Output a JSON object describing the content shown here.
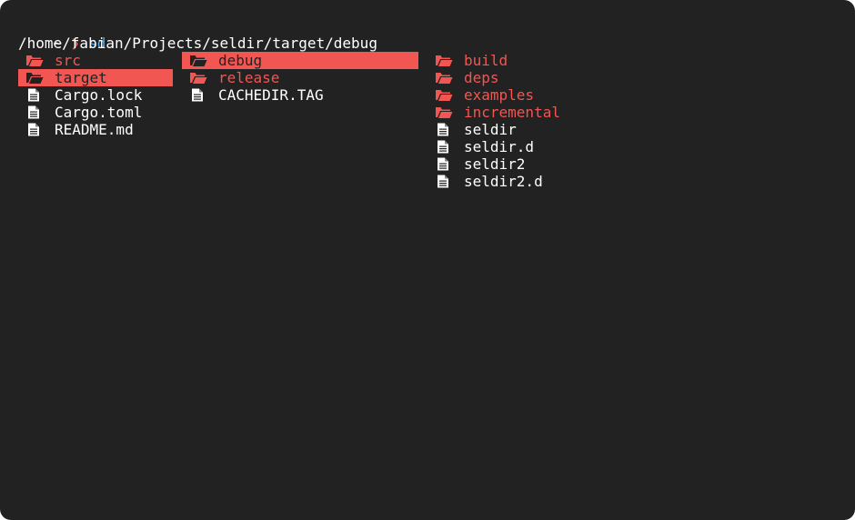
{
  "prompt": {
    "tilde": "~",
    "chevron": "❯",
    "command": "sd"
  },
  "current_path": "/home/fabian/Projects/seldir/target/debug",
  "colors": {
    "background": "#222222",
    "directory": "#f25652",
    "file": "#ffffff",
    "selection": "#f25652",
    "command": "#5aa9e6"
  },
  "columns": [
    [
      {
        "name": "src",
        "type": "dir",
        "icon": "folder-open-icon"
      },
      {
        "name": "target",
        "type": "dir",
        "icon": "folder-open-icon",
        "selected": true
      },
      {
        "name": "Cargo.lock",
        "type": "file",
        "icon": "file-icon"
      },
      {
        "name": "Cargo.toml",
        "type": "file",
        "icon": "file-icon"
      },
      {
        "name": "README.md",
        "type": "file",
        "icon": "file-icon"
      }
    ],
    [
      {
        "name": "debug",
        "type": "dir",
        "icon": "folder-open-icon",
        "selected": true
      },
      {
        "name": "release",
        "type": "dir",
        "icon": "folder-open-icon"
      },
      {
        "name": "CACHEDIR.TAG",
        "type": "file",
        "icon": "file-icon"
      }
    ],
    [
      {
        "name": "build",
        "type": "dir",
        "icon": "folder-open-icon"
      },
      {
        "name": "deps",
        "type": "dir",
        "icon": "folder-open-icon"
      },
      {
        "name": "examples",
        "type": "dir",
        "icon": "folder-open-icon"
      },
      {
        "name": "incremental",
        "type": "dir",
        "icon": "folder-open-icon"
      },
      {
        "name": "seldir",
        "type": "file",
        "icon": "file-icon"
      },
      {
        "name": "seldir.d",
        "type": "file",
        "icon": "file-icon"
      },
      {
        "name": "seldir2",
        "type": "file",
        "icon": "file-icon"
      },
      {
        "name": "seldir2.d",
        "type": "file",
        "icon": "file-icon"
      }
    ]
  ]
}
